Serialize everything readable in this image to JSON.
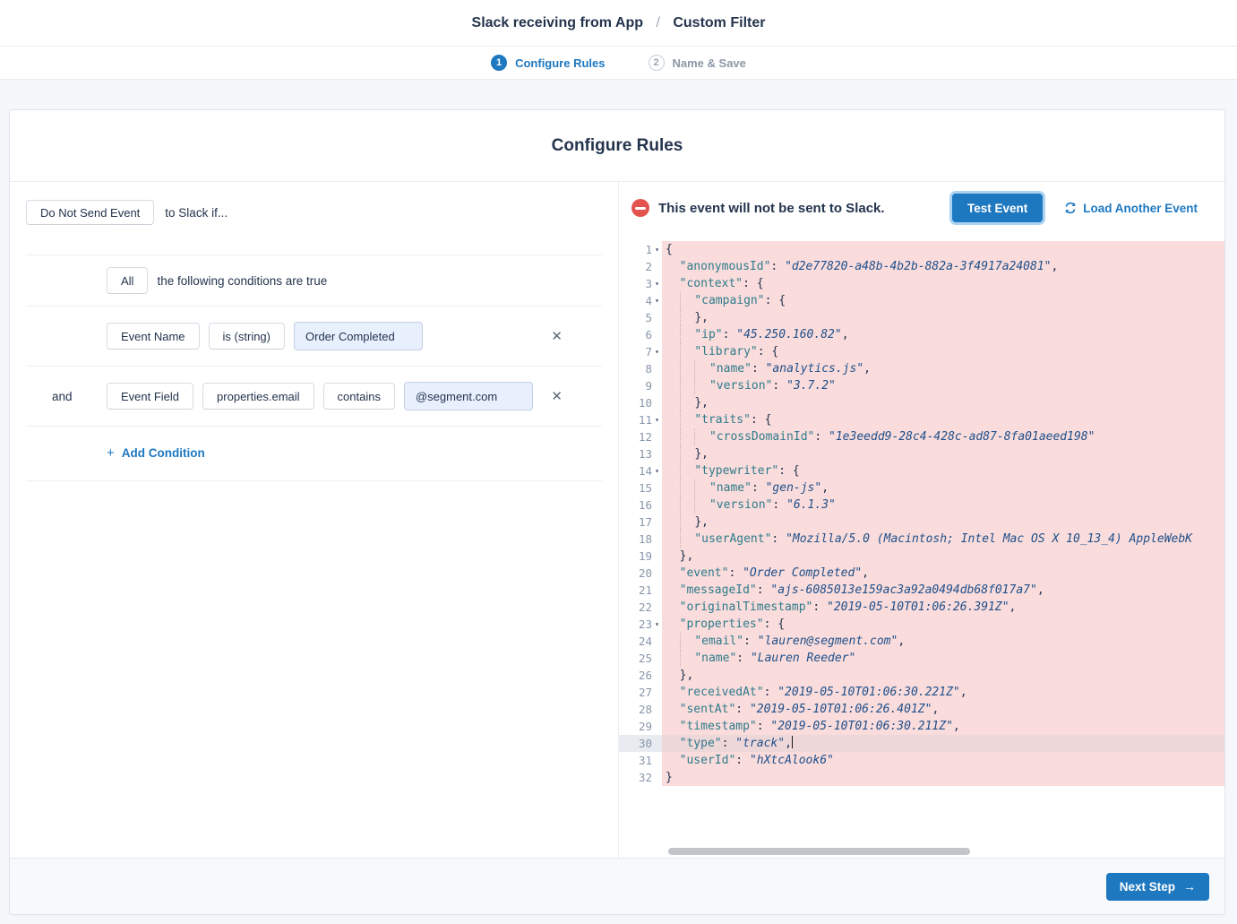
{
  "header": {
    "breadcrumb_left": "Slack receiving from App",
    "breadcrumb_sep": "/",
    "breadcrumb_right": "Custom Filter"
  },
  "steps": [
    {
      "num": "1",
      "label": "Configure Rules"
    },
    {
      "num": "2",
      "label": "Name & Save"
    }
  ],
  "card": {
    "title": "Configure Rules"
  },
  "filter": {
    "action_label": "Do Not Send Event",
    "action_suffix": "to Slack if...",
    "operator_label": "All",
    "operator_suffix": "the following conditions are true",
    "conditions": [
      {
        "join": "",
        "fields": [
          "Event Name",
          "is (string)"
        ],
        "value": "Order Completed"
      },
      {
        "join": "and",
        "fields": [
          "Event Field",
          "properties.email",
          "contains"
        ],
        "value": "@segment.com"
      }
    ],
    "add_condition": {
      "plus": "+",
      "label": "Add Condition"
    }
  },
  "preview": {
    "status_text": "This event will not be sent to Slack.",
    "test_button": "Test Event",
    "load_link": "Load Another Event"
  },
  "footer": {
    "next_button": "Next Step",
    "arrow": "→"
  },
  "icons": {
    "close": "✕",
    "fold": "▾",
    "refresh": "refresh-circular-arrows",
    "minus_circle": "do-not-send"
  },
  "colors": {
    "accent_blue": "#1e78c0",
    "link_blue": "#1d78c1",
    "status_red": "#e4524e",
    "code_highlight_pink": "#f9dcdb",
    "active_line_pink": "#eed7d8",
    "code_key": "#2e7b8c",
    "code_string": "#20508c",
    "input_fill": "#e8f0fe"
  },
  "editor": {
    "active_line": 30,
    "lines": [
      {
        "n": 1,
        "fold": true,
        "ind": 0,
        "seg": [
          [
            "p",
            "{"
          ]
        ]
      },
      {
        "n": 2,
        "ind": 2,
        "seg": [
          [
            "k",
            "\"anonymousId\""
          ],
          [
            "p",
            ": "
          ],
          [
            "s",
            "\"d2e77820-a48b-4b2b-882a-3f4917a24081\""
          ],
          [
            "p",
            ","
          ]
        ]
      },
      {
        "n": 3,
        "fold": true,
        "ind": 2,
        "seg": [
          [
            "k",
            "\"context\""
          ],
          [
            "p",
            ": {"
          ]
        ]
      },
      {
        "n": 4,
        "fold": true,
        "ind": 4,
        "seg": [
          [
            "k",
            "\"campaign\""
          ],
          [
            "p",
            ": {"
          ]
        ]
      },
      {
        "n": 5,
        "ind": 4,
        "seg": [
          [
            "p",
            "},"
          ]
        ]
      },
      {
        "n": 6,
        "ind": 4,
        "seg": [
          [
            "k",
            "\"ip\""
          ],
          [
            "p",
            ": "
          ],
          [
            "s",
            "\"45.250.160.82\""
          ],
          [
            "p",
            ","
          ]
        ]
      },
      {
        "n": 7,
        "fold": true,
        "ind": 4,
        "seg": [
          [
            "k",
            "\"library\""
          ],
          [
            "p",
            ": {"
          ]
        ]
      },
      {
        "n": 8,
        "ind": 6,
        "seg": [
          [
            "k",
            "\"name\""
          ],
          [
            "p",
            ": "
          ],
          [
            "s",
            "\"analytics.js\""
          ],
          [
            "p",
            ","
          ]
        ]
      },
      {
        "n": 9,
        "ind": 6,
        "seg": [
          [
            "k",
            "\"version\""
          ],
          [
            "p",
            ": "
          ],
          [
            "s",
            "\"3.7.2\""
          ]
        ]
      },
      {
        "n": 10,
        "ind": 4,
        "seg": [
          [
            "p",
            "},"
          ]
        ]
      },
      {
        "n": 11,
        "fold": true,
        "ind": 4,
        "seg": [
          [
            "k",
            "\"traits\""
          ],
          [
            "p",
            ": {"
          ]
        ]
      },
      {
        "n": 12,
        "ind": 6,
        "seg": [
          [
            "k",
            "\"crossDomainId\""
          ],
          [
            "p",
            ": "
          ],
          [
            "s",
            "\"1e3eedd9-28c4-428c-ad87-8fa01aeed198\""
          ]
        ]
      },
      {
        "n": 13,
        "ind": 4,
        "seg": [
          [
            "p",
            "},"
          ]
        ]
      },
      {
        "n": 14,
        "fold": true,
        "ind": 4,
        "seg": [
          [
            "k",
            "\"typewriter\""
          ],
          [
            "p",
            ": {"
          ]
        ]
      },
      {
        "n": 15,
        "ind": 6,
        "seg": [
          [
            "k",
            "\"name\""
          ],
          [
            "p",
            ": "
          ],
          [
            "s",
            "\"gen-js\""
          ],
          [
            "p",
            ","
          ]
        ]
      },
      {
        "n": 16,
        "ind": 6,
        "seg": [
          [
            "k",
            "\"version\""
          ],
          [
            "p",
            ": "
          ],
          [
            "s",
            "\"6.1.3\""
          ]
        ]
      },
      {
        "n": 17,
        "ind": 4,
        "seg": [
          [
            "p",
            "},"
          ]
        ]
      },
      {
        "n": 18,
        "ind": 4,
        "seg": [
          [
            "k",
            "\"userAgent\""
          ],
          [
            "p",
            ": "
          ],
          [
            "s",
            "\"Mozilla/5.0 (Macintosh; Intel Mac OS X 10_13_4) AppleWebK"
          ]
        ]
      },
      {
        "n": 19,
        "ind": 2,
        "seg": [
          [
            "p",
            "},"
          ]
        ]
      },
      {
        "n": 20,
        "ind": 2,
        "seg": [
          [
            "k",
            "\"event\""
          ],
          [
            "p",
            ": "
          ],
          [
            "s",
            "\"Order Completed\""
          ],
          [
            "p",
            ","
          ]
        ]
      },
      {
        "n": 21,
        "ind": 2,
        "seg": [
          [
            "k",
            "\"messageId\""
          ],
          [
            "p",
            ": "
          ],
          [
            "s",
            "\"ajs-6085013e159ac3a92a0494db68f017a7\""
          ],
          [
            "p",
            ","
          ]
        ]
      },
      {
        "n": 22,
        "ind": 2,
        "seg": [
          [
            "k",
            "\"originalTimestamp\""
          ],
          [
            "p",
            ": "
          ],
          [
            "s",
            "\"2019-05-10T01:06:26.391Z\""
          ],
          [
            "p",
            ","
          ]
        ]
      },
      {
        "n": 23,
        "fold": true,
        "ind": 2,
        "seg": [
          [
            "k",
            "\"properties\""
          ],
          [
            "p",
            ": {"
          ]
        ]
      },
      {
        "n": 24,
        "ind": 4,
        "seg": [
          [
            "k",
            "\"email\""
          ],
          [
            "p",
            ": "
          ],
          [
            "s",
            "\"lauren@segment.com\""
          ],
          [
            "p",
            ","
          ]
        ]
      },
      {
        "n": 25,
        "ind": 4,
        "seg": [
          [
            "k",
            "\"name\""
          ],
          [
            "p",
            ": "
          ],
          [
            "s",
            "\"Lauren Reeder\""
          ]
        ]
      },
      {
        "n": 26,
        "ind": 2,
        "seg": [
          [
            "p",
            "},"
          ]
        ]
      },
      {
        "n": 27,
        "ind": 2,
        "seg": [
          [
            "k",
            "\"receivedAt\""
          ],
          [
            "p",
            ": "
          ],
          [
            "s",
            "\"2019-05-10T01:06:30.221Z\""
          ],
          [
            "p",
            ","
          ]
        ]
      },
      {
        "n": 28,
        "ind": 2,
        "seg": [
          [
            "k",
            "\"sentAt\""
          ],
          [
            "p",
            ": "
          ],
          [
            "s",
            "\"2019-05-10T01:06:26.401Z\""
          ],
          [
            "p",
            ","
          ]
        ]
      },
      {
        "n": 29,
        "ind": 2,
        "seg": [
          [
            "k",
            "\"timestamp\""
          ],
          [
            "p",
            ": "
          ],
          [
            "s",
            "\"2019-05-10T01:06:30.211Z\""
          ],
          [
            "p",
            ","
          ]
        ]
      },
      {
        "n": 30,
        "ind": 2,
        "cursor": true,
        "seg": [
          [
            "k",
            "\"type\""
          ],
          [
            "p",
            ": "
          ],
          [
            "s",
            "\"track\""
          ],
          [
            "p",
            ","
          ]
        ]
      },
      {
        "n": 31,
        "ind": 2,
        "seg": [
          [
            "k",
            "\"userId\""
          ],
          [
            "p",
            ": "
          ],
          [
            "s",
            "\"hXtcAlook6\""
          ]
        ]
      },
      {
        "n": 32,
        "ind": 0,
        "seg": [
          [
            "p",
            "}"
          ]
        ]
      }
    ]
  }
}
